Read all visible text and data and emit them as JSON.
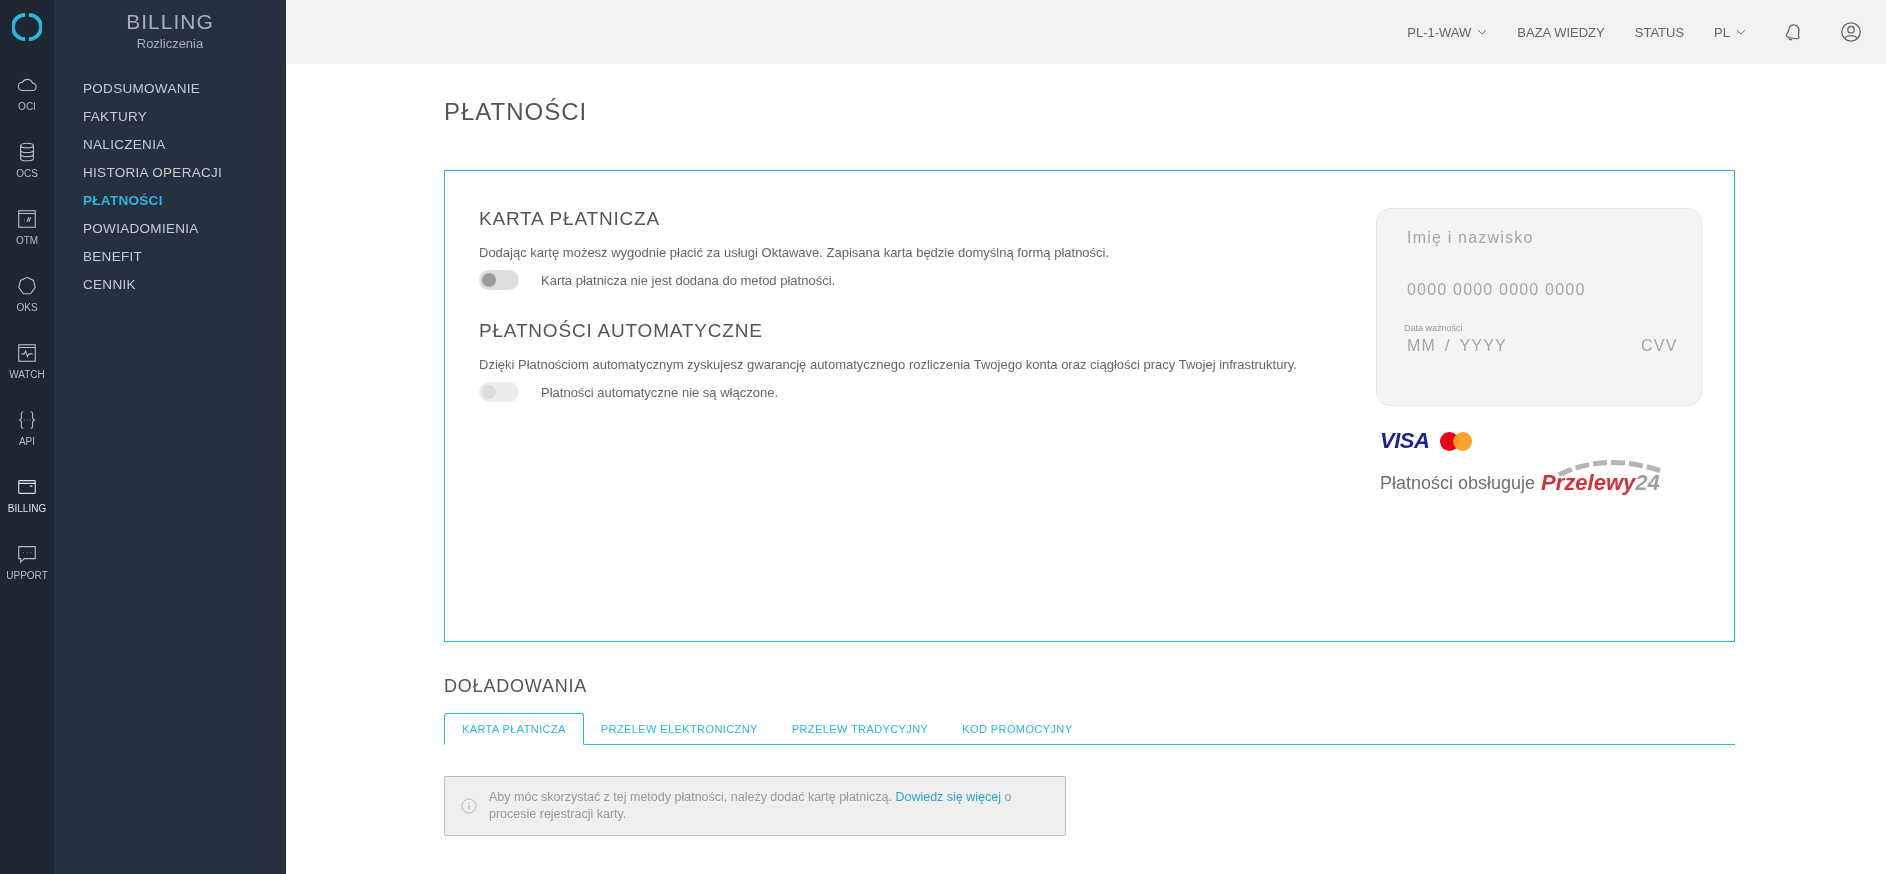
{
  "rail": {
    "items": [
      {
        "label": "OCI",
        "kind": "cloud",
        "selected": false
      },
      {
        "label": "OCS",
        "kind": "database",
        "selected": false
      },
      {
        "label": "OTM",
        "kind": "window",
        "selected": false
      },
      {
        "label": "OKS",
        "kind": "heptagon",
        "selected": false
      },
      {
        "label": "WATCH",
        "kind": "monitor",
        "selected": false
      },
      {
        "label": "API",
        "kind": "braces",
        "selected": false
      },
      {
        "label": "BILLING",
        "kind": "card",
        "selected": true
      },
      {
        "label": "UPPORT",
        "kind": "chat",
        "selected": false
      }
    ]
  },
  "sidebar": {
    "title": "BILLING",
    "subtitle": "Rozliczenia",
    "items": [
      {
        "label": "PODSUMOWANIE",
        "selected": false
      },
      {
        "label": "FAKTURY",
        "selected": false
      },
      {
        "label": "NALICZENIA",
        "selected": false
      },
      {
        "label": "HISTORIA OPERACJI",
        "selected": false
      },
      {
        "label": "PŁATNOŚCI",
        "selected": true
      },
      {
        "label": "POWIADOMIENIA",
        "selected": false
      },
      {
        "label": "BENEFIT",
        "selected": false
      },
      {
        "label": "CENNIK",
        "selected": false
      }
    ]
  },
  "topbar": {
    "items": [
      {
        "label": "PL-1-WAW",
        "dropdown": true
      },
      {
        "label": "BAZA WIEDZY",
        "dropdown": false
      },
      {
        "label": "STATUS",
        "dropdown": false
      },
      {
        "label": "PL",
        "dropdown": true
      }
    ]
  },
  "page_title": "PŁATNOŚCI",
  "sections": [
    {
      "title": "KARTA PŁATNICZA",
      "description": "Dodając kartę możesz wygodnie płacić za usługi Oktawave. Zapisana karta będzie domyślną formą płatności.",
      "toggle": {
        "on": false,
        "disabled": false,
        "label": "Karta płatnicza nie jest dodana do metod płatności."
      }
    },
    {
      "title": "PŁATNOŚCI AUTOMATYCZNE",
      "description": "Dzięki Płatnościom automatycznym zyskujesz gwarancję automatycznego rozliczenia Twojego konta oraz ciągłości pracy Twojej infrastruktury.",
      "toggle": {
        "on": false,
        "disabled": true,
        "label": "Płatności automatyczne nie są włączone."
      }
    }
  ],
  "card_form": {
    "name": {
      "placeholder": "Imię i nazwisko"
    },
    "number": {
      "placeholder": "0000 0000 0000 0000"
    },
    "expiry_label": "Data ważności",
    "month": {
      "placeholder": "MM"
    },
    "separator": "/",
    "year": {
      "placeholder": "YYYY"
    },
    "cvv": {
      "placeholder": "CVV"
    }
  },
  "payment_logos": {
    "visa": "VISA",
    "provider_text": "Płatności obsługuje",
    "provider_name": "Przelewy",
    "provider_number": "24"
  },
  "topups": {
    "title": "DOŁADOWANIA",
    "tabs": [
      {
        "label": "KARTA PŁATNICZA",
        "selected": true
      },
      {
        "label": "PRZELEW ELEKTRONICZNY",
        "selected": false
      },
      {
        "label": "PRZELEW TRADYCYJNY",
        "selected": false
      },
      {
        "label": "KOD PROMOCYJNY",
        "selected": false
      }
    ],
    "notice": {
      "text": "Aby móc skorzystać z tej metody płatności, należy dodać kartę płatniczą.",
      "link": "Dowiedz się więcej",
      "text_after": "o procesie rejestracji karty."
    }
  }
}
